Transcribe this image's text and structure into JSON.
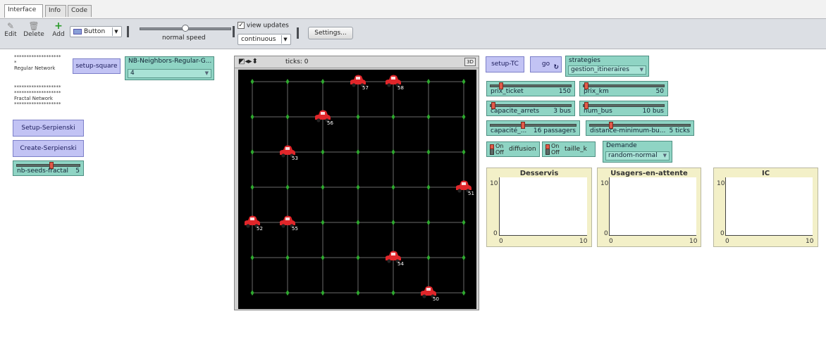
{
  "tabs": [
    "Interface",
    "Info",
    "Code"
  ],
  "toolbar": {
    "edit": "Edit",
    "delete": "Delete",
    "add": "Add",
    "widget_type": "Button",
    "speed_label": "normal speed",
    "speed_fraction": 0.5,
    "view_updates_label": "view updates",
    "view_updates_checked": true,
    "update_mode": "continuous",
    "settings": "Settings..."
  },
  "left_panel": {
    "note_regular": "*******************\n*\nRegular Network",
    "note_fractal": "*******************\n*******************\nFractal Network\n*******************",
    "setup_square": "setup-square",
    "nb_neighbors": {
      "name": "NB-Neighbors-Regular-G...",
      "value": "4"
    },
    "setup_serpienski": "Setup-Serpienski",
    "create_serpienski": "Create-Serpienski",
    "nb_seeds": {
      "name": "nb-seeds-fractal",
      "value": "5",
      "fraction": 0.55
    }
  },
  "view": {
    "ticks_label": "ticks: 0",
    "label_3d": "3D",
    "grid_cols": 7,
    "grid_rows": 7,
    "buses": [
      {
        "label": "57",
        "col": 3,
        "row": 0
      },
      {
        "label": "58",
        "col": 4,
        "row": 0
      },
      {
        "label": "56",
        "col": 2,
        "row": 1
      },
      {
        "label": "53",
        "col": 1,
        "row": 2
      },
      {
        "label": "51",
        "col": 6,
        "row": 3
      },
      {
        "label": "52",
        "col": 0,
        "row": 4
      },
      {
        "label": "55",
        "col": 1,
        "row": 4
      },
      {
        "label": "54",
        "col": 4,
        "row": 5
      },
      {
        "label": "50",
        "col": 5,
        "row": 6
      }
    ]
  },
  "controls": {
    "setup_tc": "setup-TC",
    "go": "go",
    "strategies": {
      "name": "strategies",
      "value": "gestion_itineraires"
    },
    "prix_ticket": {
      "name": "prix_ticket",
      "value": "150",
      "fraction": 0.12
    },
    "prix_km": {
      "name": "prix_km",
      "value": "50",
      "fraction": 0.02
    },
    "capacite_arrets": {
      "name": "capacite_arrets",
      "value": "3 bus",
      "fraction": 0.02
    },
    "num_bus": {
      "name": "num_bus",
      "value": "10 bus",
      "fraction": 0.02
    },
    "capacite_bus": {
      "name": "capacité_...",
      "value": "16 passagers",
      "fraction": 0.38
    },
    "distance_min": {
      "name": "distance-minimum-bu...",
      "value": "5 ticks",
      "fraction": 0.2
    },
    "diffusion": {
      "name": "diffusion",
      "on": "On",
      "off": "Off"
    },
    "taille_k": {
      "name": "taille_k",
      "on": "On",
      "off": "Off"
    },
    "demande": {
      "name": "Demande",
      "value": "random-normal"
    }
  },
  "plots": [
    {
      "title": "Desservis",
      "ymax": "10",
      "ymin": "0",
      "xmin": "0",
      "xmax": "10"
    },
    {
      "title": "Usagers-en-attente",
      "ymax": "10",
      "ymin": "0",
      "xmin": "0",
      "xmax": "10"
    },
    {
      "title": "IC",
      "ymax": "10",
      "ymin": "0",
      "xmin": "0",
      "xmax": "10"
    }
  ],
  "colors": {
    "button": "#c2c3f4",
    "slider": "#8fd4c4",
    "plot_bg": "#f3f0c8",
    "world_bg": "#000000",
    "grid_line": "#6a6a6a",
    "node": "#2fa82f",
    "bus": "#e0262a"
  }
}
